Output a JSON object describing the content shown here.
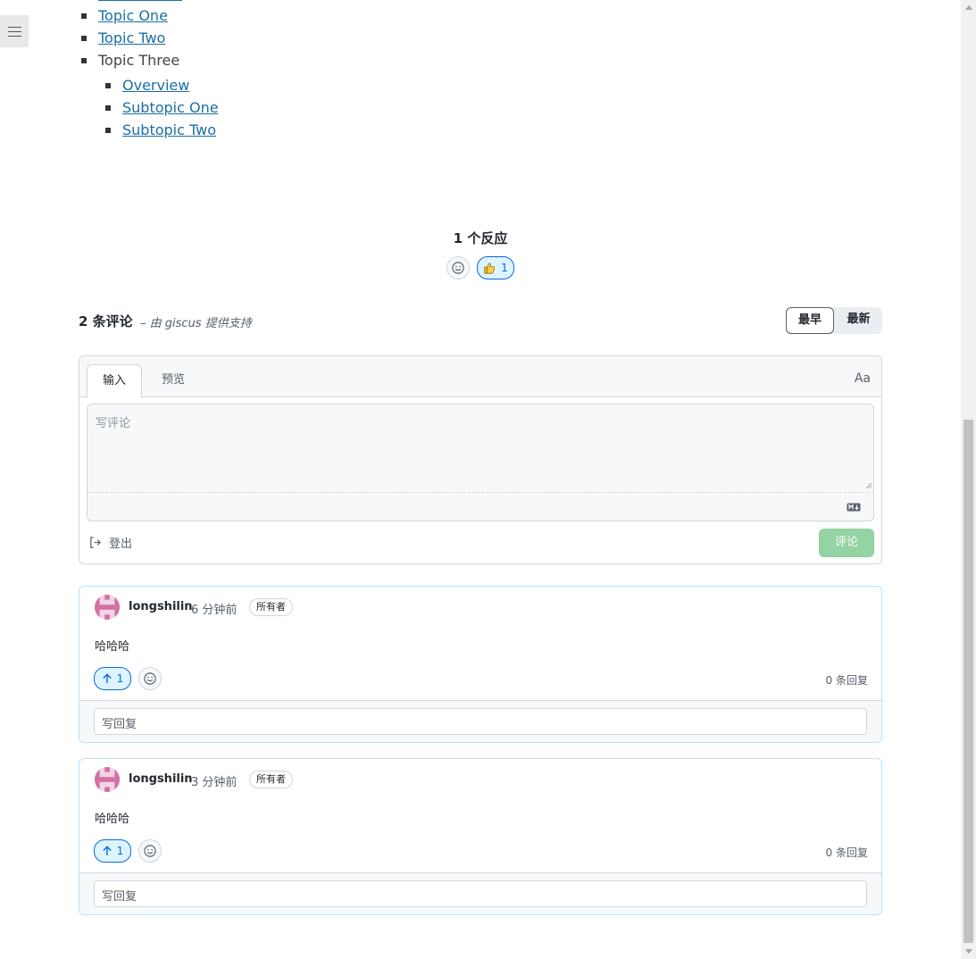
{
  "toc": {
    "items": [
      {
        "label": "Topic One",
        "link": true
      },
      {
        "label": "Topic Two",
        "link": true
      },
      {
        "label": "Topic Three",
        "link": false
      }
    ],
    "subitems": [
      {
        "label": "Overview"
      },
      {
        "label": "Subtopic One"
      },
      {
        "label": "Subtopic Two"
      }
    ]
  },
  "reactions": {
    "title": "1 个反应",
    "thumbs_count": "1"
  },
  "comments_header": {
    "count_label": "2 条评论",
    "powered_by": "– 由 giscus 提供支持",
    "sort_oldest": "最早",
    "sort_newest": "最新"
  },
  "editor": {
    "tab_input": "输入",
    "tab_preview": "预览",
    "font_toggle": "Aa",
    "placeholder": "写评论",
    "signout_label": "登出",
    "submit_label": "评论"
  },
  "comments": [
    {
      "author": "longshilin",
      "time": "6 分钟前",
      "badge": "所有者",
      "body": "哈哈哈",
      "upvotes": "1",
      "replies": "0 条回复",
      "reply_placeholder": "写回复"
    },
    {
      "author": "longshilin",
      "time": "3 分钟前",
      "badge": "所有者",
      "body": "哈哈哈",
      "upvotes": "1",
      "replies": "0 条回复",
      "reply_placeholder": "写回复"
    }
  ],
  "colors": {
    "link": "#1a6fa6",
    "accent_blue": "#0969da",
    "submit_disabled": "#94d3a2",
    "comment_border": "#b6e3ff"
  }
}
